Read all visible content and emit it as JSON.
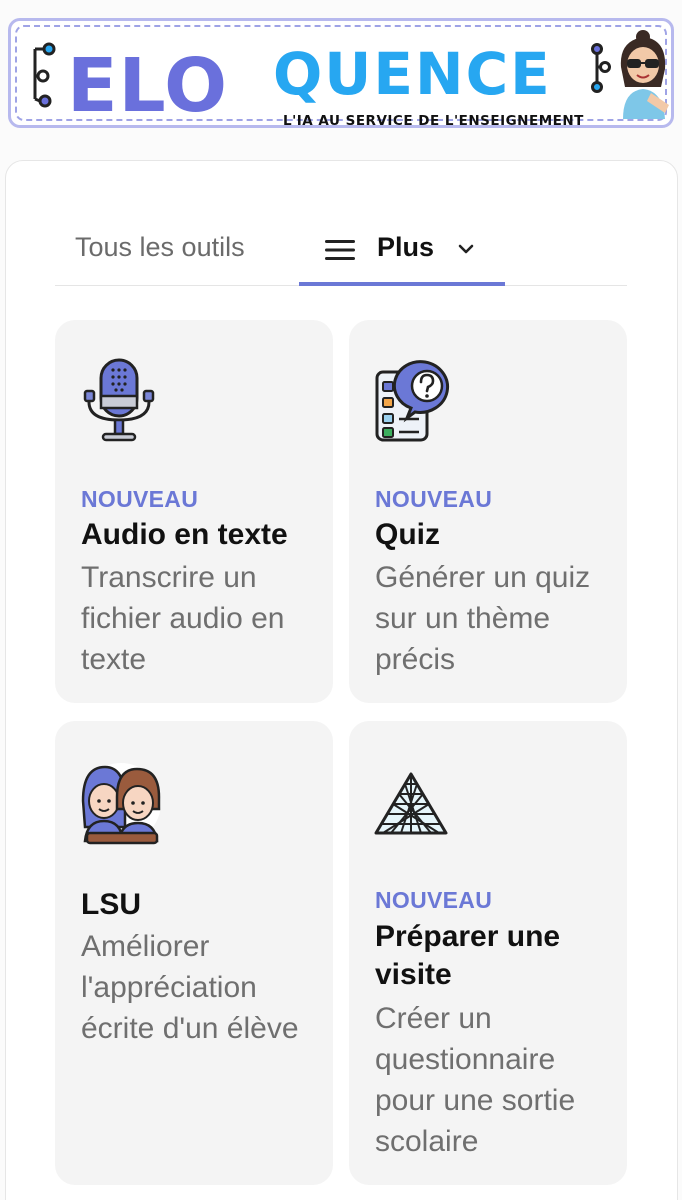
{
  "banner": {
    "logo_left": "ELO",
    "logo_right": "QUENCE",
    "tagline": "L'IA AU SERVICE DE L'ENSEIGNEMENT",
    "colors": {
      "elo": "#6a70dc",
      "quence": "#27a7f1",
      "border": "#b7b9ee"
    }
  },
  "tabs": {
    "all_tools": "Tous les outils",
    "more": "Plus",
    "active_color": "#6b78d6"
  },
  "tools": [
    {
      "icon": "microphone-icon",
      "badge": "NOUVEAU",
      "title": "Audio en texte",
      "description": "Transcrire un fichier audio en texte"
    },
    {
      "icon": "quiz-icon",
      "badge": "NOUVEAU",
      "title": "Quiz",
      "description": "Générer un quiz sur un thème précis"
    },
    {
      "icon": "students-icon",
      "badge": "",
      "title": "LSU",
      "description": "Améliorer l'appréciation écrite d'un élève"
    },
    {
      "icon": "pyramid-icon",
      "badge": "NOUVEAU",
      "title": "Préparer une visite",
      "description": "Créer un questionnaire pour une sortie scolaire"
    }
  ]
}
